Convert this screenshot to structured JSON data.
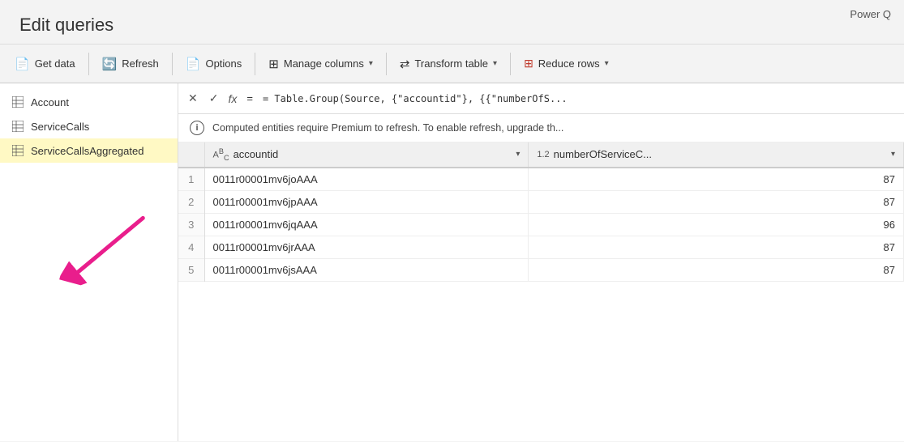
{
  "app": {
    "label": "Power Q"
  },
  "title": "Edit queries",
  "toolbar": {
    "get_data": "Get data",
    "refresh": "Refresh",
    "options": "Options",
    "manage_columns": "Manage columns",
    "transform_table": "Transform table",
    "reduce_rows": "Reduce rows"
  },
  "sidebar": {
    "items": [
      {
        "id": "account",
        "label": "Account",
        "active": false
      },
      {
        "id": "servicecalls",
        "label": "ServiceCalls",
        "active": false
      },
      {
        "id": "servicecallsaggregated",
        "label": "ServiceCallsAggregated",
        "active": true
      }
    ]
  },
  "formula_bar": {
    "formula": "= Table.Group(Source, {\"accountid\"}, {{\"numberOfS..."
  },
  "info_banner": {
    "text": "Computed entities require Premium to refresh. To enable refresh, upgrade th..."
  },
  "table": {
    "columns": [
      {
        "id": "accountid",
        "label": "accountid",
        "type": "ABC"
      },
      {
        "id": "numberOfServiceC",
        "label": "numberOfServiceC...",
        "type": "1.2"
      }
    ],
    "rows": [
      {
        "num": 1,
        "accountid": "0011r00001mv6joAAA",
        "numberOfServiceC": "87"
      },
      {
        "num": 2,
        "accountid": "0011r00001mv6jpAAA",
        "numberOfServiceC": "87"
      },
      {
        "num": 3,
        "accountid": "0011r00001mv6jqAAA",
        "numberOfServiceC": "96"
      },
      {
        "num": 4,
        "accountid": "0011r00001mv6jrAAA",
        "numberOfServiceC": "87"
      },
      {
        "num": 5,
        "accountid": "0011r00001mv6jsAAA",
        "numberOfServiceC": "87"
      }
    ]
  }
}
